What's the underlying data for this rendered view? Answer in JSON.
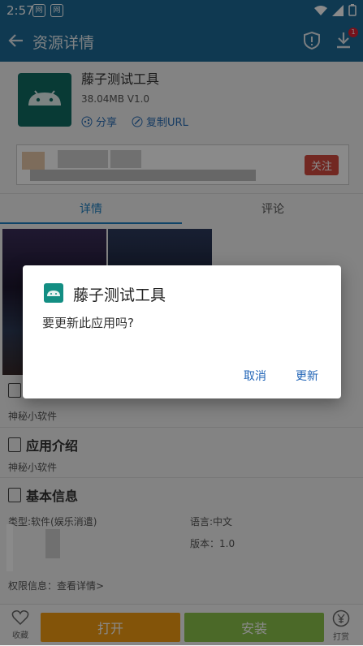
{
  "status": {
    "time": "2:57"
  },
  "appbar": {
    "title": "资源详情",
    "badge": "1"
  },
  "app": {
    "name": "藤子测试工具",
    "meta": "38.04MB   V1.0",
    "share_label": "分享",
    "copy_url_label": "复制URL"
  },
  "author": {
    "follow_label": "关注"
  },
  "tabs": [
    {
      "label": "详情"
    },
    {
      "label": "评论"
    }
  ],
  "sections": {
    "section1_desc": "神秘小软件",
    "intro": {
      "title": "应用介绍",
      "desc": "神秘小软件"
    },
    "basic": {
      "title": "基本信息",
      "type": "类型:软件(娱乐消遣)",
      "language": "语言:中文",
      "version": "版本：1.0",
      "permission": "权限信息：查看详情>"
    }
  },
  "bottom": {
    "fav_label": "收藏",
    "open_label": "打开",
    "install_label": "安装",
    "tip_label": "打赏"
  },
  "dialog": {
    "title": "藤子测试工具",
    "message": "要更新此应用吗?",
    "cancel_label": "取消",
    "update_label": "更新"
  }
}
